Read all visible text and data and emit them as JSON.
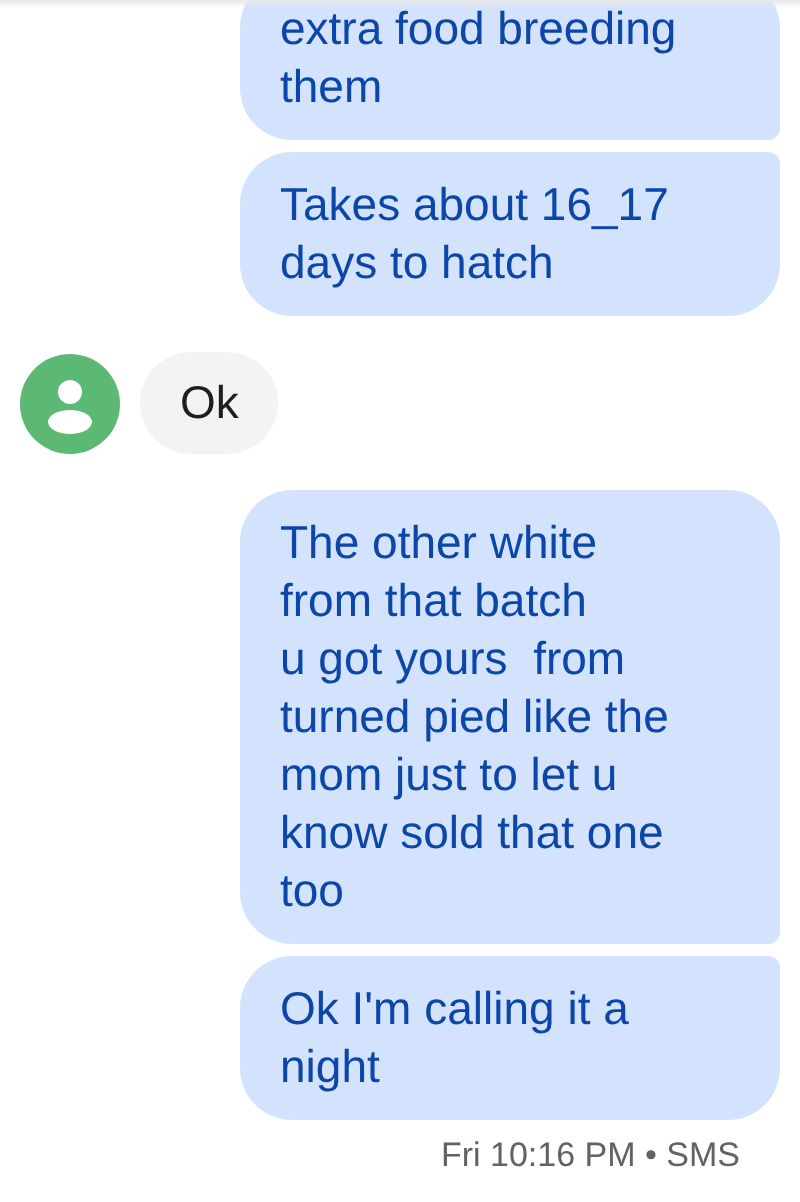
{
  "messages": [
    {
      "kind": "outgoing",
      "text": "extra food breeding\nthem"
    },
    {
      "kind": "outgoing",
      "text": "Takes about 16_17\ndays to hatch"
    },
    {
      "kind": "incoming",
      "text": "Ok"
    },
    {
      "kind": "outgoing",
      "text": "The other white\nfrom that batch\nu got yours  from\nturned pied like the\nmom just to let u\nknow sold that one\ntoo"
    },
    {
      "kind": "outgoing",
      "text": "Ok I'm calling it a\nnight"
    }
  ],
  "timestamp": "Fri 10:16 PM • SMS"
}
